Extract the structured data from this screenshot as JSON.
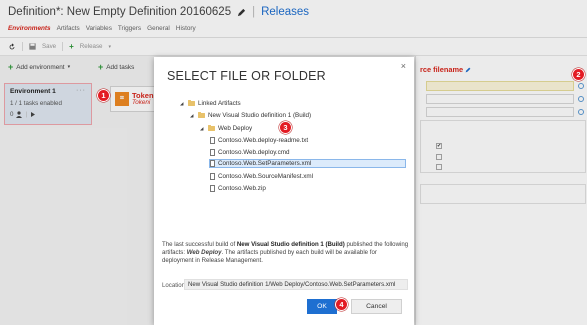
{
  "header": {
    "title": "Definition*: New Empty Definition 20160625",
    "separator": "|",
    "breadcrumb": "Releases",
    "tabs": [
      "Environments",
      "Artifacts",
      "Variables",
      "Triggers",
      "General",
      "History"
    ]
  },
  "toolbar": {
    "save_label": "Save",
    "release_label": "Release"
  },
  "left": {
    "add_environment": "Add environment",
    "environment": {
      "name": "Environment 1",
      "menu": "···",
      "tasks": "1 / 1 tasks enabled",
      "approvers": "0"
    }
  },
  "middle": {
    "add_tasks": "Add tasks",
    "task": {
      "name": "Token",
      "subtitle": "Tokeni"
    }
  },
  "right": {
    "header": "rce filename"
  },
  "dialog": {
    "title": "SELECT FILE OR FOLDER",
    "close": "×",
    "tree": [
      {
        "label": "Linked Artifacts",
        "type": "folder",
        "expanded": true,
        "level": 0
      },
      {
        "label": "New Visual Studio definition 1 (Build)",
        "type": "folder",
        "expanded": true,
        "level": 1
      },
      {
        "label": "Web Deploy",
        "type": "folder",
        "expanded": true,
        "level": 2
      },
      {
        "label": "Contoso.Web.deploy-readme.txt",
        "type": "file",
        "level": 3
      },
      {
        "label": "Contoso.Web.deploy.cmd",
        "type": "file",
        "level": 3
      },
      {
        "label": "Contoso.Web.SetParameters.xml",
        "type": "file",
        "level": 3,
        "selected": true
      },
      {
        "label": "Contoso.Web.SourceManifest.xml",
        "type": "file",
        "level": 3
      },
      {
        "label": "Contoso.Web.zip",
        "type": "file",
        "level": 3
      }
    ],
    "description": {
      "p1": "The last successful build of ",
      "build": "New Visual Studio definition 1 (Build)",
      "p2": " published the following artifacts: ",
      "artifact": "Web Deploy",
      "p3": ". The artifacts published by each build will be available for deployment in Release Management."
    },
    "location_label": "Location",
    "location_value": "New Visual Studio definition 1/Web Deploy/Contoso.Web.SetParameters.xml",
    "ok_label": "OK",
    "cancel_label": "Cancel"
  },
  "badges": [
    "1",
    "2",
    "3",
    "4"
  ],
  "colors": {
    "accent": "#1e6fd1",
    "active_tab": "#d9261c",
    "badge": "#e31b23",
    "folder": "#e8c26b",
    "add_green": "#2f9a3a"
  }
}
